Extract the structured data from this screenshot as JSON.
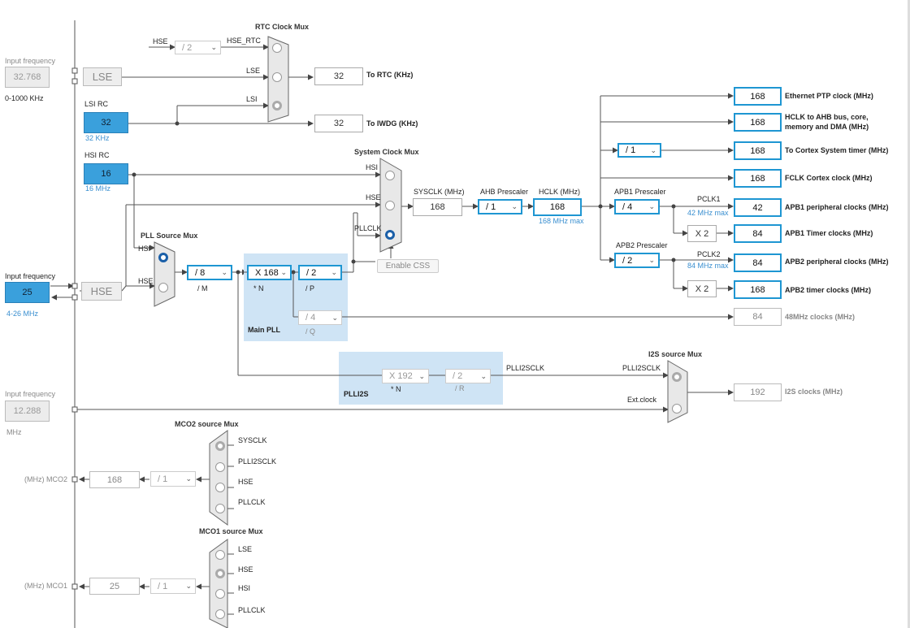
{
  "left": {
    "input_freq_label": "Input frequency",
    "lse_value": "32.768",
    "lse_range": "0-1000 KHz",
    "lse_label": "LSE",
    "lsi_title": "LSI RC",
    "lsi_value": "32",
    "lsi_freq": "32 KHz",
    "hsi_title": "HSI RC",
    "hsi_value": "16",
    "hsi_freq": "16 MHz",
    "hse_input_label": "Input frequency",
    "hse_value": "25",
    "hse_range": "4-26 MHz",
    "hse_label": "HSE",
    "i2s_input_label": "Input frequency",
    "i2s_ext_value": "12.288",
    "i2s_ext_unit": "MHz"
  },
  "rtc": {
    "mux_title": "RTC Clock Mux",
    "hse_label": "HSE",
    "div_value": "/ 2",
    "hse_rtc_label": "HSE_RTC",
    "lse_label": "LSE",
    "lsi_label": "LSI",
    "rtc_value": "32",
    "rtc_out_label": "To RTC (KHz)",
    "iwdg_value": "32",
    "iwdg_out_label": "To IWDG (KHz)"
  },
  "sysmux": {
    "title": "System Clock Mux",
    "hsi_label": "HSI",
    "hse_label": "HSE",
    "pllclk_label": "PLLCLK",
    "enable_css_label": "Enable CSS"
  },
  "pll": {
    "src_title": "PLL Source Mux",
    "hsi_label": "HSI",
    "hse_label": "HSE",
    "m_value": "/ 8",
    "m_label": "/ M",
    "n_value": "X 168",
    "n_label": "* N",
    "p_value": "/ 2",
    "p_label": "/ P",
    "q_value": "/ 4",
    "q_label": "/ Q",
    "main_label": "Main PLL"
  },
  "bus": {
    "sysclk_title": "SYSCLK (MHz)",
    "sysclk_value": "168",
    "ahb_title": "AHB Prescaler",
    "ahb_value": "/ 1",
    "hclk_title": "HCLK (MHz)",
    "hclk_value": "168",
    "hclk_max": "168 MHz max",
    "cortex_div": "/ 1",
    "apb1_title": "APB1 Prescaler",
    "apb1_value": "/ 4",
    "pclk1_label": "PCLK1",
    "pclk1_max": "42 MHz max",
    "apb1_mult": "X 2",
    "apb2_title": "APB2 Prescaler",
    "apb2_value": "/ 2",
    "pclk2_label": "PCLK2",
    "pclk2_max": "84 MHz max",
    "apb2_mult": "X 2"
  },
  "outputs": [
    {
      "value": "168",
      "label": "Ethernet PTP clock (MHz)"
    },
    {
      "value": "168",
      "label": "HCLK to AHB bus, core,",
      "label2": "memory and DMA (MHz)"
    },
    {
      "value": "168",
      "label": "To Cortex System timer (MHz)"
    },
    {
      "value": "168",
      "label": "FCLK Cortex clock (MHz)"
    },
    {
      "value": "42",
      "label": "APB1 peripheral clocks (MHz)"
    },
    {
      "value": "84",
      "label": "APB1 Timer clocks (MHz)"
    },
    {
      "value": "84",
      "label": "APB2 peripheral clocks (MHz)"
    },
    {
      "value": "168",
      "label": "APB2 timer clocks (MHz)"
    },
    {
      "value": "84",
      "label": "48MHz clocks (MHz)"
    },
    {
      "value": "192",
      "label": "I2S clocks (MHz)"
    }
  ],
  "plli2s": {
    "n_value": "X 192",
    "n_label": "* N",
    "r_value": "/ 2",
    "r_label": "/ R",
    "plli2sclk_label": "PLLI2SCLK",
    "panel_label": "PLLI2S",
    "mux_title": "I2S source Mux",
    "mux_plli2sclk": "PLLI2SCLK",
    "mux_ext": "Ext.clock"
  },
  "mco2": {
    "title": "MCO2 source Mux",
    "opt1": "SYSCLK",
    "opt2": "PLLI2SCLK",
    "opt3": "HSE",
    "opt4": "PLLCLK",
    "div": "/ 1",
    "value": "168",
    "label": "(MHz) MCO2"
  },
  "mco1": {
    "title": "MCO1 source Mux",
    "opt1": "LSE",
    "opt2": "HSE",
    "opt3": "HSI",
    "opt4": "PLLCLK",
    "div": "/ 1",
    "value": "25",
    "label": "(MHz) MCO1"
  }
}
